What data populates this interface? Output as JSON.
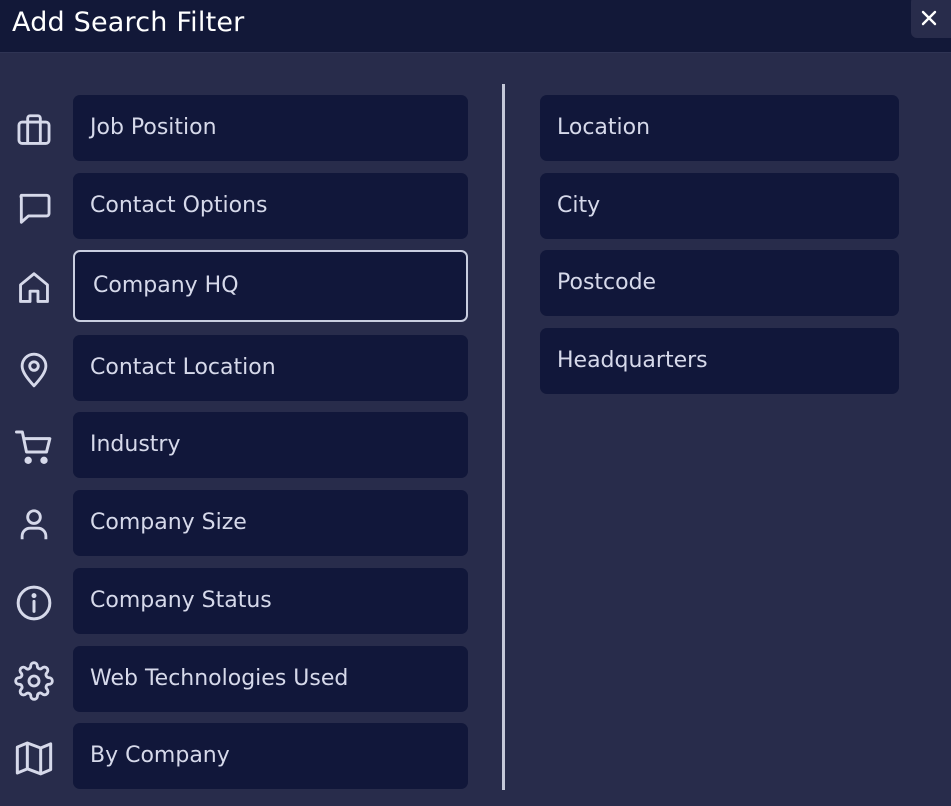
{
  "dialog": {
    "title": "Add Search Filter",
    "close_icon": "close-icon"
  },
  "left_filters": [
    {
      "label": "Job Position",
      "icon": "briefcase-icon"
    },
    {
      "label": "Contact Options",
      "icon": "message-icon"
    },
    {
      "label": "Company HQ",
      "icon": "home-icon",
      "selected": true
    },
    {
      "label": "Contact Location",
      "icon": "map-pin-icon"
    },
    {
      "label": "Industry",
      "icon": "shopping-cart-icon"
    },
    {
      "label": "Company Size",
      "icon": "user-icon"
    },
    {
      "label": "Company Status",
      "icon": "info-icon"
    },
    {
      "label": "Web Technologies Used",
      "icon": "gear-icon"
    },
    {
      "label": "By Company",
      "icon": "map-icon"
    }
  ],
  "right_filters": [
    {
      "label": "Location"
    },
    {
      "label": "City"
    },
    {
      "label": "Postcode"
    },
    {
      "label": "Headquarters"
    }
  ],
  "colors": {
    "background": "#282c4b",
    "header": "#121838",
    "button": "#11173a",
    "text": "#d6d9ea",
    "icon": "#d6d9ea",
    "selected_border": "#c9cee0",
    "divider": "#c4c8d8"
  }
}
